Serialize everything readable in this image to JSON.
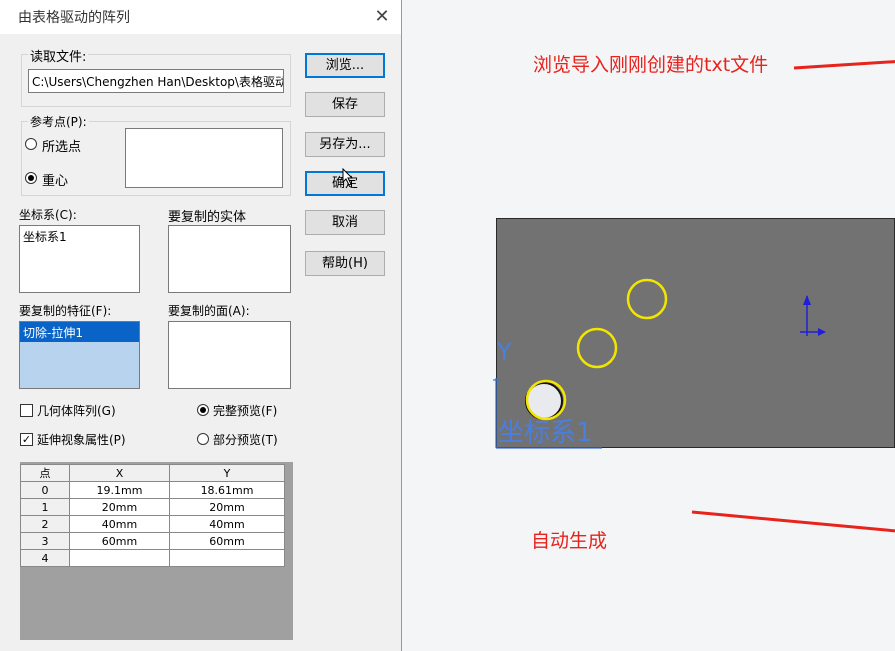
{
  "dialog": {
    "title": "由表格驱动的阵列",
    "read_file_label": "读取文件:",
    "file_path": "C:\\Users\\Chengzhen Han\\Desktop\\表格驱动阵",
    "ref_point_label": "参考点(P):",
    "radio_selected_point": "所选点",
    "radio_centroid": "重心",
    "coord_label": "坐标系(C):",
    "coord_item": "坐标系1",
    "bodies_label": "要复制的实体",
    "features_label": "要复制的特征(F):",
    "feature_item": "切除-拉伸1",
    "faces_label": "要复制的面(A):",
    "geometry_pattern": "几何体阵列(G)",
    "propagate_visual": "延伸视象属性(P)",
    "full_preview": "完整预览(F)",
    "partial_preview": "部分预览(T)",
    "buttons": {
      "browse": "浏览...",
      "save": "保存",
      "save_as": "另存为...",
      "ok": "确定",
      "cancel": "取消",
      "help": "帮助(H)"
    },
    "table": {
      "headers": [
        "点",
        "X",
        "Y"
      ],
      "rows": [
        [
          "0",
          "19.1mm",
          "18.61mm"
        ],
        [
          "1",
          "20mm",
          "20mm"
        ],
        [
          "2",
          "40mm",
          "40mm"
        ],
        [
          "3",
          "60mm",
          "60mm"
        ],
        [
          "4",
          "",
          ""
        ]
      ]
    }
  },
  "viewport": {
    "axis_y_label": "Y",
    "coord_sys_label": "坐标系1"
  },
  "annotations": {
    "browse_note": "浏览导入刚刚创建的txt文件",
    "auto_note": "自动生成",
    "color": "#e8221c"
  }
}
